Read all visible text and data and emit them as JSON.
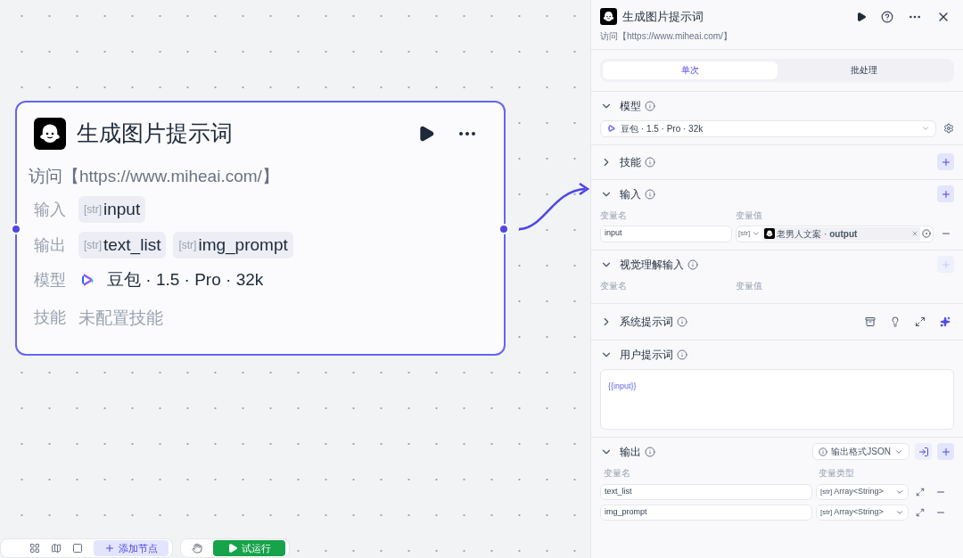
{
  "node": {
    "title": "生成图片提示词",
    "description": "访问【https://www.miheai.com/】",
    "input": {
      "label": "输入",
      "params": [
        {
          "type": "[str]",
          "name": "input"
        }
      ]
    },
    "output": {
      "label": "输出",
      "params": [
        {
          "type": "[str]",
          "name": "text_list"
        },
        {
          "type": "[str]",
          "name": "img_prompt"
        }
      ]
    },
    "model": {
      "label": "模型",
      "value": "豆包 · 1.5 · Pro · 32k"
    },
    "skills": {
      "label": "技能",
      "value": "未配置技能"
    }
  },
  "toolbar": {
    "add_node": "添加节点",
    "test_run": "试运行"
  },
  "panel": {
    "title": "生成图片提示词",
    "description": "访问【https://www.miheai.com/】",
    "tabs": [
      {
        "label": "单次",
        "selected": true
      },
      {
        "label": "批处理",
        "selected": false
      }
    ],
    "model": {
      "title": "模型",
      "expanded": true,
      "value": "豆包 · 1.5 · Pro · 32k"
    },
    "skills": {
      "title": "技能",
      "expanded": false
    },
    "input": {
      "title": "输入",
      "expanded": true,
      "col_name": "变量名",
      "col_value": "变量值",
      "rows": [
        {
          "name": "input",
          "type": "[str]",
          "reference": "老男人文案 · **output**"
        }
      ]
    },
    "vision_input": {
      "title": "视觉理解输入",
      "expanded": true,
      "col_name": "变量名",
      "col_value": "变量值"
    },
    "system_prompt": {
      "title": "系统提示词",
      "expanded": false
    },
    "user_prompt": {
      "title": "用户提示词",
      "expanded": true,
      "value": "{{input}}"
    },
    "output": {
      "title": "输出",
      "expanded": true,
      "format": "输出格式JSON",
      "col_name": "变量名",
      "col_type": "变量类型",
      "rows": [
        {
          "name": "text_list",
          "type": "[str]",
          "value_type": "Array<String>"
        },
        {
          "name": "img_prompt",
          "type": "[str]",
          "value_type": "Array<String>"
        }
      ]
    }
  }
}
